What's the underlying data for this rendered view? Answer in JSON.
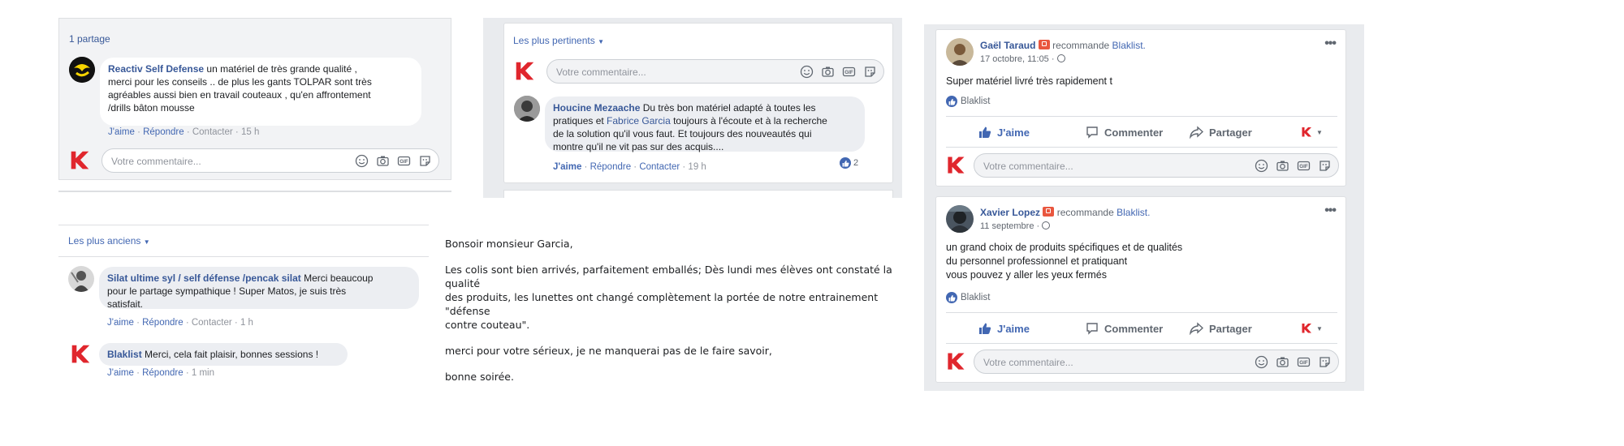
{
  "panel1": {
    "shares": "1 partage",
    "comment": {
      "author": "Reactiv Self Defense",
      "text_lines": [
        " un matériel de très grande qualité ,",
        "merci pour les conseils .. de plus les gants TOLPAR sont très",
        "agréables aussi bien en travail couteaux , qu'en affrontement",
        "/drills bâton mousse"
      ],
      "like": "J'aime",
      "reply": "Répondre",
      "contact": "Contacter",
      "time": "15 h"
    },
    "input_placeholder": "Votre commentaire..."
  },
  "panel2": {
    "sort_label": "Les plus pertinents",
    "input_placeholder": "Votre commentaire...",
    "comment": {
      "author": "Houcine Mezaache",
      "line1_rest": " Du très bon matériel adapté à toutes les",
      "line2_a": "pratiques et ",
      "mention": "Fabrice Garcia",
      "line2_b": " toujours à l'écoute et à la recherche",
      "line3": "de la solution qu'il vous faut. Et toujours des nouveautés qui",
      "line4": "montre qu'il ne vit pas sur des acquis....",
      "like": "J'aime",
      "reply": "Répondre",
      "contact": "Contacter",
      "time": "19 h",
      "reaction_count": "2"
    }
  },
  "panel3": {
    "sort_label": "Les plus anciens",
    "comment1": {
      "author": "Silat ultime syl / self défense /pencak silat",
      "line1_rest": " Merci beaucoup",
      "line2": "pour le partage sympathique ! Super Matos, je suis très",
      "line3": "satisfait.",
      "like": "J'aime",
      "reply": "Répondre",
      "contact": "Contacter",
      "time": "1 h"
    },
    "comment2": {
      "author": "Blaklist",
      "text": " Merci, cela fait plaisir, bonnes sessions !",
      "like": "J'aime",
      "reply": "Répondre",
      "time": "1 min"
    }
  },
  "letter": {
    "greeting": "Bonsoir monsieur Garcia,",
    "para1": [
      "Les colis sont bien arrivés, parfaitement emballés; Dès lundi mes élèves ont constaté la qualité",
      "des produits, les lunettes ont changé complètement la portée de notre entrainement \"défense",
      "contre couteau\"."
    ],
    "para2": "merci pour votre sérieux, je ne manquerai pas de le faire savoir,",
    "closing": "bonne soirée."
  },
  "reviews": [
    {
      "author": "Gaël Taraud",
      "recommends": "recommande",
      "page": "Blaklist.",
      "date": "17 octobre, 11:05 ·",
      "text_lines": [
        "Super matériel livré très rapidement t"
      ],
      "like_label": "Blaklist",
      "actions": {
        "like": "J'aime",
        "comment": "Commenter",
        "share": "Partager"
      },
      "input_placeholder": "Votre commentaire..."
    },
    {
      "author": "Xavier Lopez",
      "recommends": "recommande",
      "page": "Blaklist.",
      "date": "11 septembre ·",
      "text_lines": [
        "un grand choix de produits spécifiques et de qualités",
        "du personnel professionnel et pratiquant",
        "vous pouvez y aller les yeux fermés"
      ],
      "like_label": "Blaklist",
      "actions": {
        "like": "J'aime",
        "comment": "Commenter",
        "share": "Partager"
      },
      "input_placeholder": "Votre commentaire..."
    }
  ],
  "colors": {
    "brand_red": "#e0262d",
    "fb_blue": "#4267b2",
    "link": "#385898",
    "panel_bg": "#f2f3f5"
  }
}
